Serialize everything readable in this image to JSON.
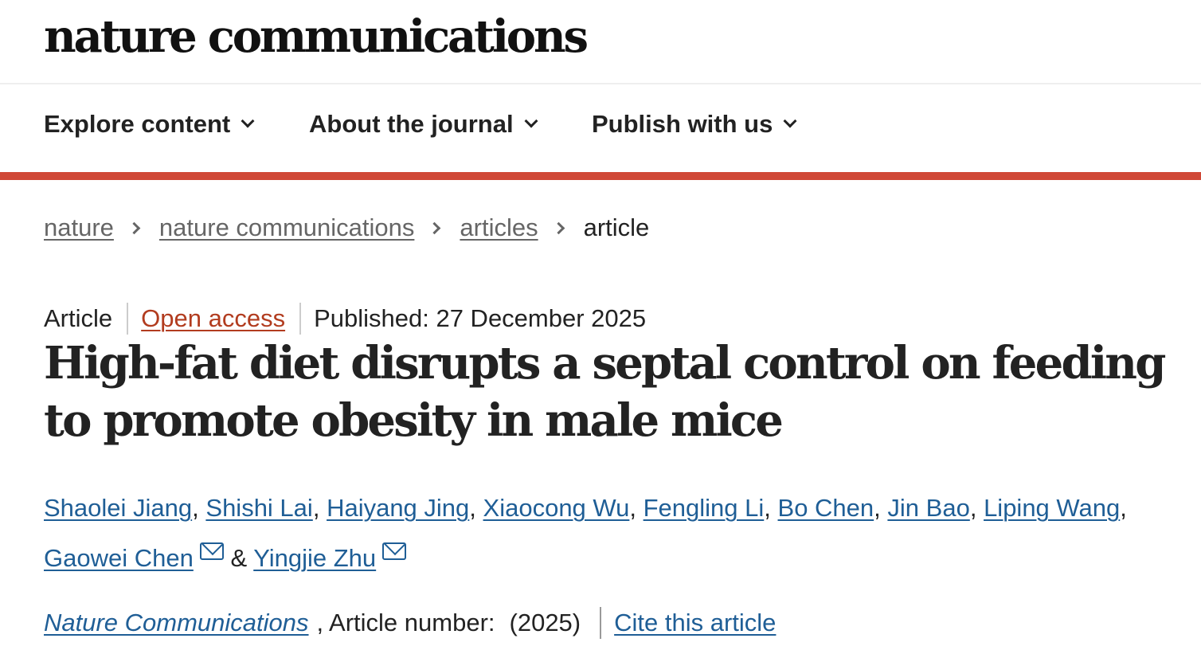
{
  "header": {
    "logo": "nature communications"
  },
  "nav": {
    "items": [
      {
        "label": "Explore content"
      },
      {
        "label": "About the journal"
      },
      {
        "label": "Publish with us"
      }
    ]
  },
  "breadcrumb": {
    "items": [
      "nature",
      "nature communications",
      "articles"
    ],
    "current": "article"
  },
  "article": {
    "type": "Article",
    "access": "Open access",
    "published": "Published: 27 December 2025",
    "title": "High-fat diet disrupts a septal control on feeding to promote obesity in male mice",
    "authors": [
      "Shaolei Jiang",
      "Shishi Lai",
      "Haiyang Jing",
      "Xiaocong Wu",
      "Fengling Li",
      "Bo Chen",
      "Jin Bao",
      "Liping Wang",
      "Gaowei Chen",
      "Yingjie Zhu"
    ],
    "author_separator": ",",
    "author_conjunction": "&",
    "journal": "Nature Communications",
    "article_number_text": ", Article number:",
    "year": "(2025)",
    "cite_label": "Cite this article"
  },
  "colors": {
    "accent_bar": "#d04837",
    "link": "#1f5e96",
    "open_access": "#b23c1f"
  }
}
